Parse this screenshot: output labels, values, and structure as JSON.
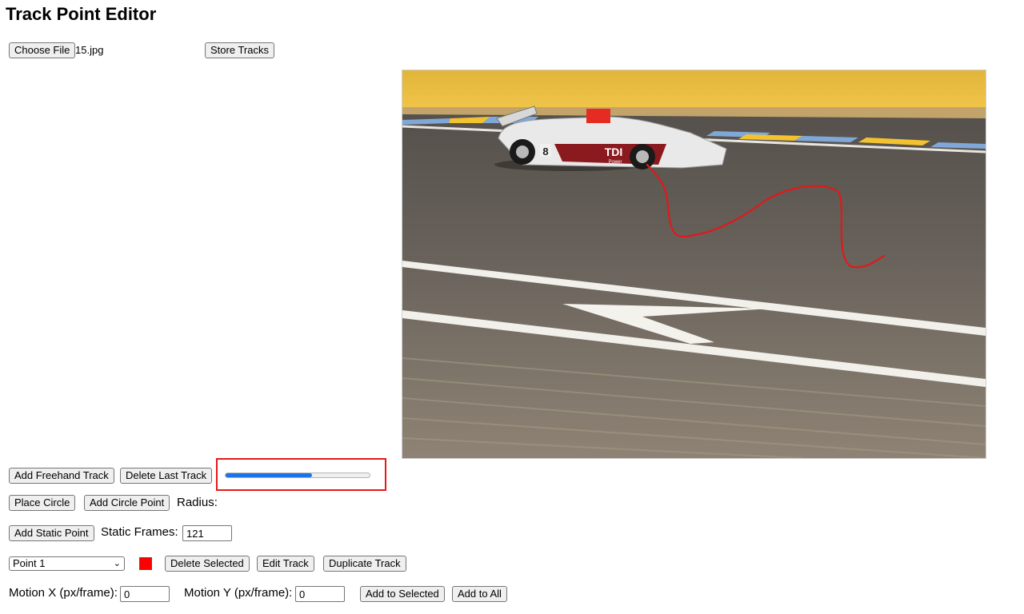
{
  "title": "Track Point Editor",
  "file": {
    "choose_label": "Choose File",
    "file_name": "15.jpg"
  },
  "store_label": "Store Tracks",
  "controls": {
    "add_freehand": "Add Freehand Track",
    "delete_last": "Delete Last Track",
    "slider_level": 0.6,
    "place_circle": "Place Circle",
    "add_circle_point": "Add Circle Point",
    "radius_label": "Radius:",
    "add_static_point": "Add Static Point",
    "static_frames_label": "Static Frames:",
    "static_frames_value": "121",
    "point_select_value": "Point 1",
    "point_color": "#ff0000",
    "delete_selected": "Delete Selected",
    "edit_track": "Edit Track",
    "duplicate_track": "Duplicate Track",
    "motion_x_label": "Motion X (px/frame):",
    "motion_x_value": "0",
    "motion_y_label": "Motion Y (px/frame):",
    "motion_y_value": "0",
    "add_to_selected": "Add to Selected",
    "add_to_all": "Add to All"
  },
  "canvas": {
    "car_number": "8",
    "car_sponsor": "TDI",
    "car_sponsor_sub": "Power",
    "track_color": "#e0191b",
    "accent_selection": "#e8171c",
    "slider_fill": "#1a73e8"
  }
}
